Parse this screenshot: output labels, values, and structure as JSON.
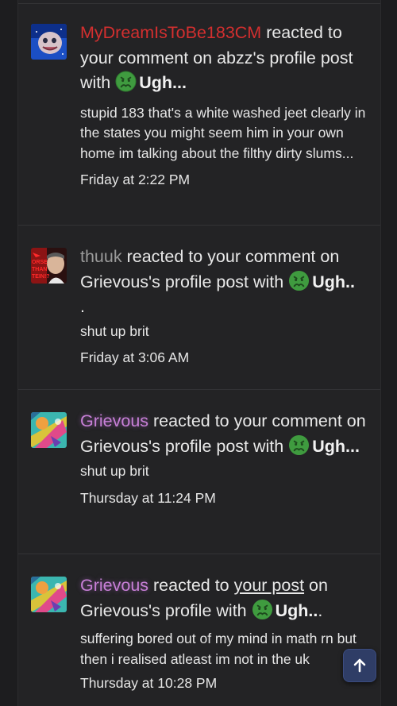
{
  "alerts": [
    {
      "username": "MyDreamIsToBe183CM",
      "text_before_link": " reacted to your comment on abzz's profile post with ",
      "reaction": "Ugh...",
      "snippet": "stupid 183 that's a white washed jeet clearly in the states you might seem him in your own home im talking about the filthy dirty slums...",
      "time": "Friday at 2:22 PM",
      "avatar": "smiling-face-avatar"
    },
    {
      "username": "thuuk",
      "text_before_link": " reacted to your comment on Grievous's profile post with ",
      "reaction": "Ugh..",
      "trailing": ".",
      "snippet": "shut up brit",
      "time": "Friday at 3:06 AM",
      "avatar": "news-thumbnail-avatar"
    },
    {
      "username": "Grievous",
      "text_before_link": " reacted to your comment on Grievous's profile post with ",
      "reaction": "Ugh...",
      "snippet": "shut up brit",
      "time": "Thursday at 11:24 PM",
      "avatar": "colorful-art-avatar"
    },
    {
      "username": "Grievous",
      "text_before_link": " reacted to ",
      "link": "your post",
      "text_after_link": " on Grievous's profile with ",
      "reaction": "Ugh..",
      "trailing": ".",
      "snippet": "suffering bored out of my mind in math rn but then i realised atleast im not in the uk",
      "time": "Thursday at 10:28 PM",
      "avatar": "colorful-art-avatar"
    }
  ],
  "icons": {
    "reaction_emoji": "nauseated-face-icon",
    "scroll_top": "arrow-up-icon"
  },
  "colors": {
    "background": "#1d1d1f",
    "panel": "#232325",
    "username_red": "#d32f2f",
    "username_gray": "#9a9a9a",
    "username_purple": "#c77fd6",
    "emoji_green": "#3f9b3f",
    "scroll_button": "#2f3d66"
  }
}
